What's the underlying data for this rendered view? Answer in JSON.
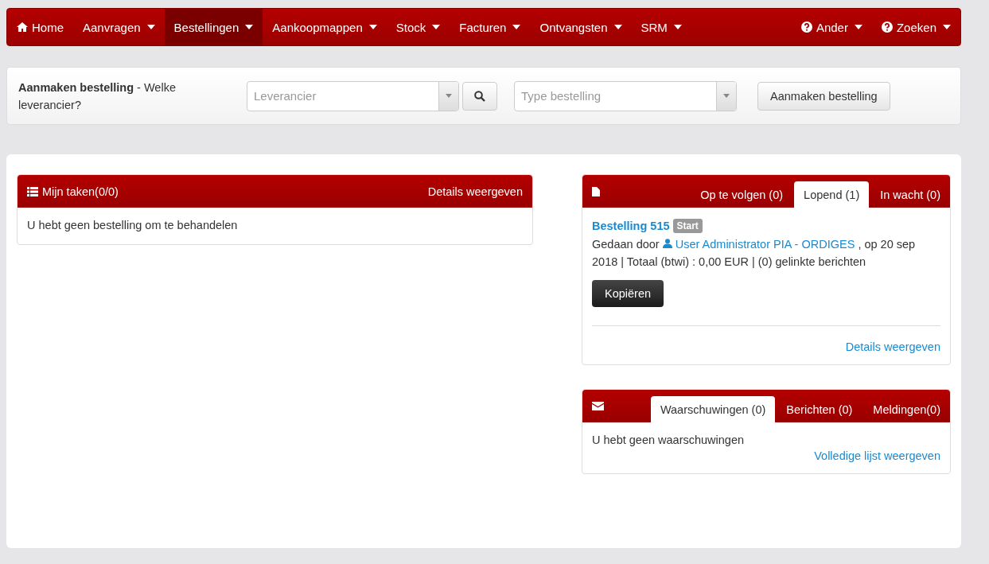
{
  "nav": {
    "left": [
      {
        "label": "Home",
        "kind": "home",
        "selected": false
      },
      {
        "label": "Aanvragen",
        "kind": "menu",
        "selected": false
      },
      {
        "label": "Bestellingen",
        "kind": "menu",
        "selected": true
      },
      {
        "label": "Aankoopmappen",
        "kind": "menu",
        "selected": false
      },
      {
        "label": "Stock",
        "kind": "menu",
        "selected": false
      },
      {
        "label": "Facturen",
        "kind": "menu",
        "selected": false
      },
      {
        "label": "Ontvangsten",
        "kind": "menu",
        "selected": false
      },
      {
        "label": "SRM",
        "kind": "menu",
        "selected": false
      }
    ],
    "right": [
      {
        "label": "Ander",
        "kind": "help",
        "selected": false
      },
      {
        "label": "Zoeken",
        "kind": "help",
        "selected": false
      }
    ]
  },
  "create_bar": {
    "prompt": "**Aanmaken bestelling** - Welke leverancier?",
    "supplier_field": {
      "placeholder": "Leverancier"
    },
    "order_type_field": {
      "placeholder": "Type bestelling"
    },
    "button": "Aanmaken bestelling"
  },
  "tasks": {
    "title": "Mijn taken(0/0)",
    "link": "Details weergeven",
    "message": "U hebt geen bestelling om te behandelen"
  },
  "orders": {
    "tabs": [
      {
        "label": "Op te volgen (0)",
        "selected": false
      },
      {
        "label": "Lopend (1)",
        "selected": true
      },
      {
        "label": "In wacht (0)",
        "selected": false
      }
    ],
    "order": {
      "title": "Bestelling 515",
      "badge": "Start",
      "by": "Gedaan door",
      "user": "User Administrator PIA - ORDIGES",
      "details": ", op 20 sep 2018 | Totaal (btwi)  : 0,00  EUR | (0) gelinkte berichten",
      "copy_button": "Kopiëren"
    },
    "link": "Details weergeven"
  },
  "messages": {
    "tabs": [
      {
        "label": "Waarschuwingen (0)",
        "selected": true
      },
      {
        "label": "Berichten (0)",
        "selected": false
      },
      {
        "label": "Meldingen(0)",
        "selected": false
      }
    ],
    "message": "U hebt geen waarschuwingen",
    "link": "Volledige lijst weergeven"
  }
}
